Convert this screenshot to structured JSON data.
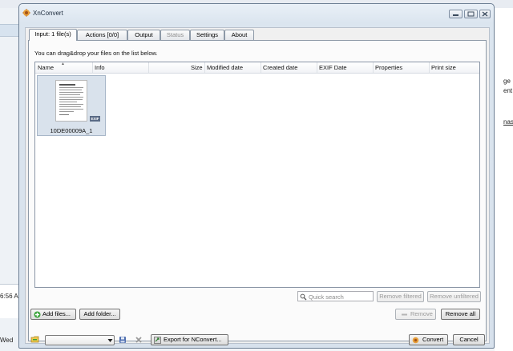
{
  "background": {
    "right_fragments": [
      "ge",
      "ent",
      "nas"
    ],
    "left_fragments": [
      "6:56 A",
      "Wed"
    ]
  },
  "window": {
    "title": "XnConvert"
  },
  "tabs": [
    {
      "label": "Input: 1 file(s)",
      "active": true,
      "disabled": false
    },
    {
      "label": "Actions [0/0]",
      "active": false,
      "disabled": false
    },
    {
      "label": "Output",
      "active": false,
      "disabled": false
    },
    {
      "label": "Status",
      "active": false,
      "disabled": true
    },
    {
      "label": "Settings",
      "active": false,
      "disabled": false
    },
    {
      "label": "About",
      "active": false,
      "disabled": false
    }
  ],
  "input_tab": {
    "hint": "You can drag&drop your files on the list below.",
    "columns": [
      "Name",
      "Info",
      "Size",
      "Modified date",
      "Created date",
      "EXIF Date",
      "Properties",
      "Print size"
    ],
    "files": [
      {
        "name": "10DE00009A_1",
        "badge": "EXIF"
      }
    ],
    "search_placeholder": "Quick search",
    "remove_filtered": "Remove filtered",
    "remove_unfiltered": "Remove unfiltered",
    "add_files": "Add files...",
    "add_folder": "Add folder...",
    "remove": "Remove",
    "remove_all": "Remove all"
  },
  "footer": {
    "preset_value": "",
    "export_label": "Export for NConvert...",
    "convert_label": "Convert",
    "cancel_label": "Cancel"
  },
  "colors": {
    "accent": "#6d7f94",
    "thumb_selection": "#d9e2ec",
    "add_icon_green": "#3aa33a"
  },
  "icons": [
    "xnconvert-app-icon",
    "minimize-icon",
    "maximize-icon",
    "close-icon",
    "search-icon",
    "add-icon",
    "remove-icon",
    "folder-icon",
    "save-icon",
    "delete-icon",
    "export-icon",
    "convert-icon"
  ]
}
